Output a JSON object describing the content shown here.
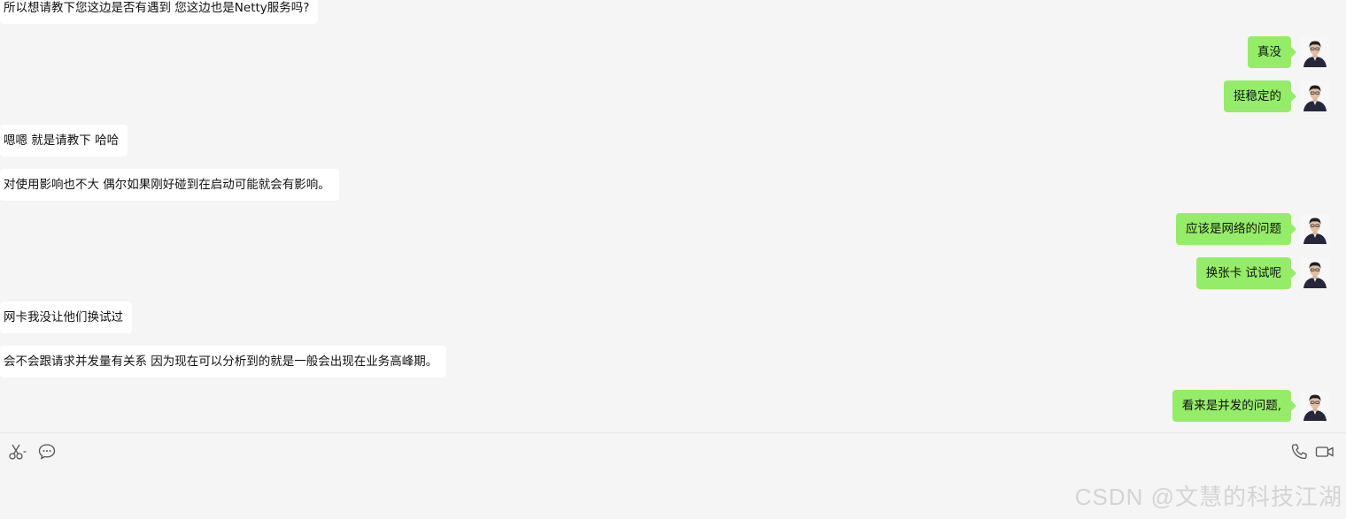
{
  "colors": {
    "background": "#f5f5f5",
    "incoming_bubble": "#ffffff",
    "outgoing_bubble": "#95ec69",
    "watermark": "#d4d4d4"
  },
  "messages": [
    {
      "side": "left",
      "text": "所以想请教下您这边是否有遇到 您这边也是Netty服务吗?"
    },
    {
      "side": "right",
      "text": "真没"
    },
    {
      "side": "right",
      "text": "挺稳定的"
    },
    {
      "side": "left",
      "text": "嗯嗯 就是请教下  哈哈"
    },
    {
      "side": "left",
      "text": "对使用影响也不大  偶尔如果刚好碰到在启动可能就会有影响。"
    },
    {
      "side": "right",
      "text": "应该是网络的问题"
    },
    {
      "side": "right",
      "text": "换张卡 试试呢"
    },
    {
      "side": "left",
      "text": "网卡我没让他们换试过"
    },
    {
      "side": "left",
      "text": "会不会跟请求并发量有关系  因为现在可以分析到的就是一般会出现在业务高峰期。"
    },
    {
      "side": "right",
      "text": "看来是并发的问题,"
    }
  ],
  "toolbar": {
    "left_icons": [
      "scissors-icon",
      "chat-bubble-icon"
    ],
    "right_icons": [
      "phone-icon",
      "video-call-icon"
    ]
  },
  "watermark": "CSDN @文慧的科技江湖"
}
